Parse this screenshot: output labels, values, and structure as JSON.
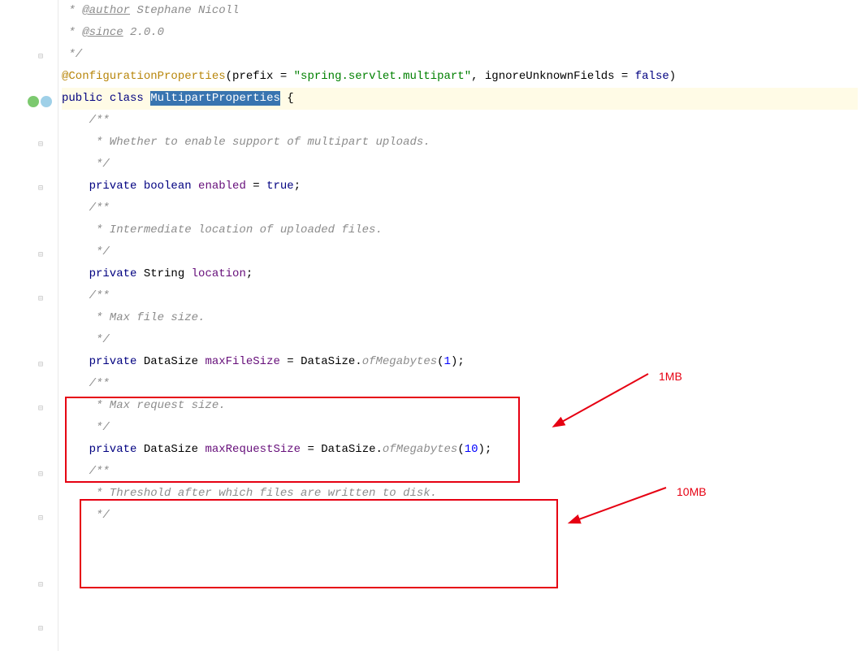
{
  "code": {
    "l1_pre": " * ",
    "l1_tag": "@author",
    "l1_post": " Stephane Nicoll",
    "l2_pre": " * ",
    "l2_tag": "@since",
    "l2_post": " 2.0.0",
    "l3": " */",
    "l4_ann": "@ConfigurationProperties",
    "l4_mid": "(prefix = ",
    "l4_str": "\"spring.servlet.multipart\"",
    "l4_mid2": ", ignoreUnknownFields = ",
    "l4_false": "false",
    "l4_end": ")",
    "l5_kw1": "public",
    "l5_kw2": "class",
    "l5_sel": "MultipartProperties",
    "l5_end": " {",
    "blank": "",
    "jd1": "    /**",
    "jd2": "     * Whether to enable support of multipart uploads.",
    "jd3": "     */",
    "f1_kw": "    private ",
    "f1_type": "boolean ",
    "f1_name": "enabled",
    "f1_eq": " = ",
    "f1_val": "true",
    "f1_end": ";",
    "jd4": "    /**",
    "jd5": "     * Intermediate location of uploaded files.",
    "jd6": "     */",
    "f2_kw": "    private ",
    "f2_type": "String ",
    "f2_name": "location",
    "f2_end": ";",
    "jd7": "    /**",
    "jd8": "     * Max file size.",
    "jd9": "     */",
    "f3_kw": "    private ",
    "f3_type": "DataSize ",
    "f3_name": "maxFileSize",
    "f3_eq": " = DataSize.",
    "f3_meth": "ofMegabytes",
    "f3_open": "(",
    "f3_num": "1",
    "f3_close": ");",
    "jd10": "    /**",
    "jd11": "     * Max request size.",
    "jd12": "     */",
    "f4_kw": "    private ",
    "f4_type": "DataSize ",
    "f4_name": "maxRequestSize",
    "f4_eq": " = DataSize.",
    "f4_meth": "ofMegabytes",
    "f4_open": "(",
    "f4_num": "10",
    "f4_close": ");",
    "jd13": "    /**",
    "jd14": "     * Threshold after which files are written to disk.",
    "jd15": "     */"
  },
  "annotations": {
    "label1": "1MB",
    "label2": "10MB"
  }
}
